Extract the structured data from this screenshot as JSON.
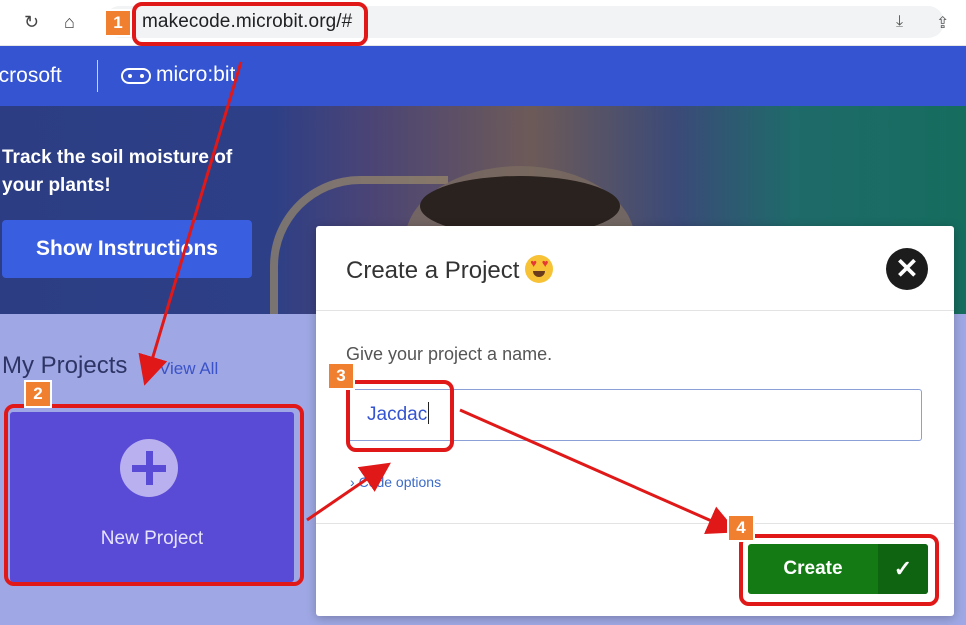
{
  "browser": {
    "url": "makecode.microbit.org/#"
  },
  "header": {
    "brand": "icrosoft",
    "product": "micro:bit"
  },
  "hero": {
    "title": "Track the soil moisture of your plants!",
    "button_label": "Show Instructions"
  },
  "projects": {
    "heading": "My Projects",
    "view_all": "View All",
    "new_project_label": "New Project"
  },
  "dialog": {
    "title": "Create a Project",
    "prompt": "Give your project a name.",
    "input_value": "Jacdac",
    "code_options": "Code options",
    "create_label": "Create"
  },
  "annotations": {
    "badges": [
      "1",
      "2",
      "3",
      "4"
    ]
  },
  "colors": {
    "header": "#3454d1",
    "create_button": "#137a14",
    "annotation": "#e01818",
    "badge": "#f08030"
  }
}
